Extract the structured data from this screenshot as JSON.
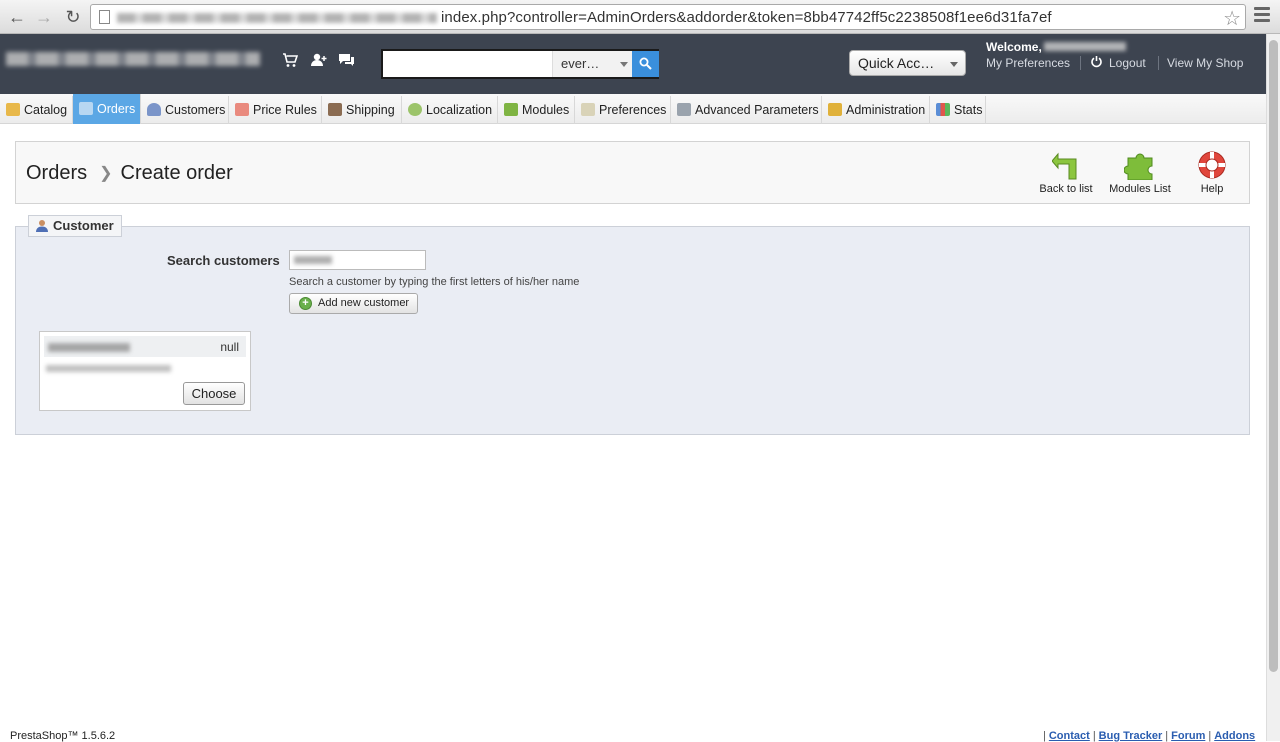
{
  "browser": {
    "url_visible": "index.php?controller=AdminOrders&addorder&token=8bb47742ff5c2238508f1ee6d31fa7ef"
  },
  "header": {
    "search": {
      "value": "",
      "scope": "ever…"
    },
    "quick_access": "Quick Acc…",
    "welcome": "Welcome,",
    "links": {
      "preferences": "My Preferences",
      "logout": "Logout",
      "view_shop": "View My Shop"
    }
  },
  "tabs": [
    {
      "label": "Catalog",
      "active": false
    },
    {
      "label": "Orders",
      "active": true
    },
    {
      "label": "Customers",
      "active": false
    },
    {
      "label": "Price Rules",
      "active": false
    },
    {
      "label": "Shipping",
      "active": false
    },
    {
      "label": "Localization",
      "active": false
    },
    {
      "label": "Modules",
      "active": false
    },
    {
      "label": "Preferences",
      "active": false
    },
    {
      "label": "Advanced Parameters",
      "active": false
    },
    {
      "label": "Administration",
      "active": false
    },
    {
      "label": "Stats",
      "active": false
    }
  ],
  "toolbar": {
    "breadcrumb": [
      "Orders",
      "Create order"
    ],
    "buttons": {
      "back": "Back to list",
      "modules": "Modules List",
      "help": "Help"
    }
  },
  "customer": {
    "legend": "Customer",
    "search_label": "Search customers",
    "hint": "Search a customer by typing the first letters of his/her name",
    "add_button": "Add new customer",
    "result": {
      "tag": "null",
      "choose": "Choose"
    }
  },
  "footer": {
    "left": "PrestaShop™ 1.5.6.2",
    "links": [
      "Contact",
      "Bug Tracker",
      "Forum",
      "Addons"
    ]
  },
  "colors": {
    "header_bg": "#3d4450",
    "active_tab": "#5ba7e5",
    "search_button": "#3a8fdc",
    "panel_bg": "#eaedf4"
  }
}
